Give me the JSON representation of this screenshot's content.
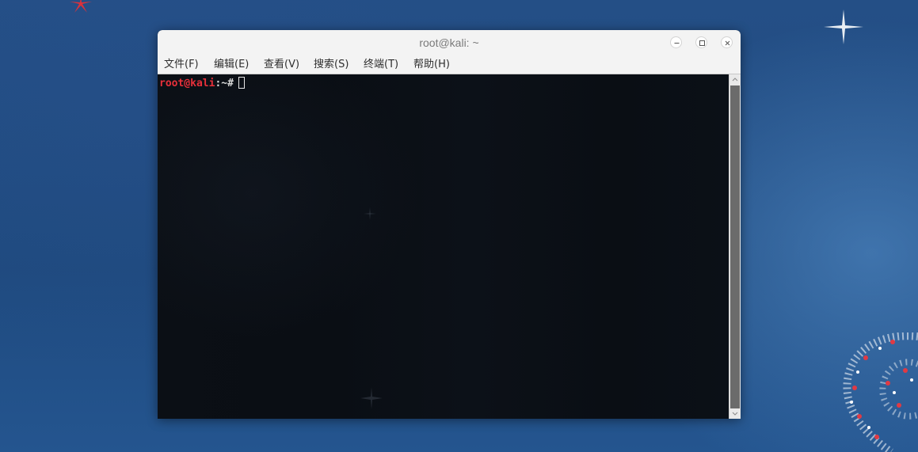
{
  "window": {
    "title": "root@kali: ~"
  },
  "menubar": {
    "items": [
      {
        "label": "文件(F)"
      },
      {
        "label": "编辑(E)"
      },
      {
        "label": "查看(V)"
      },
      {
        "label": "搜索(S)"
      },
      {
        "label": "终端(T)"
      },
      {
        "label": "帮助(H)"
      }
    ]
  },
  "terminal": {
    "prompt_user_host": "root@kali",
    "prompt_separator": ":",
    "prompt_path_symbol": "~#"
  },
  "icons": {
    "minimize": "minimize-icon",
    "maximize": "maximize-icon",
    "close": "close-icon",
    "scroll_up": "arrow-up-icon",
    "scroll_down": "arrow-down-icon"
  },
  "colors": {
    "desktop_background": "#244f86",
    "terminal_background": "#0b0f15",
    "prompt_user": "#e8303a",
    "prompt_text": "#d9d9d9",
    "titlebar": "#f3f3f3",
    "scroll_thumb": "#6b6b6b"
  }
}
